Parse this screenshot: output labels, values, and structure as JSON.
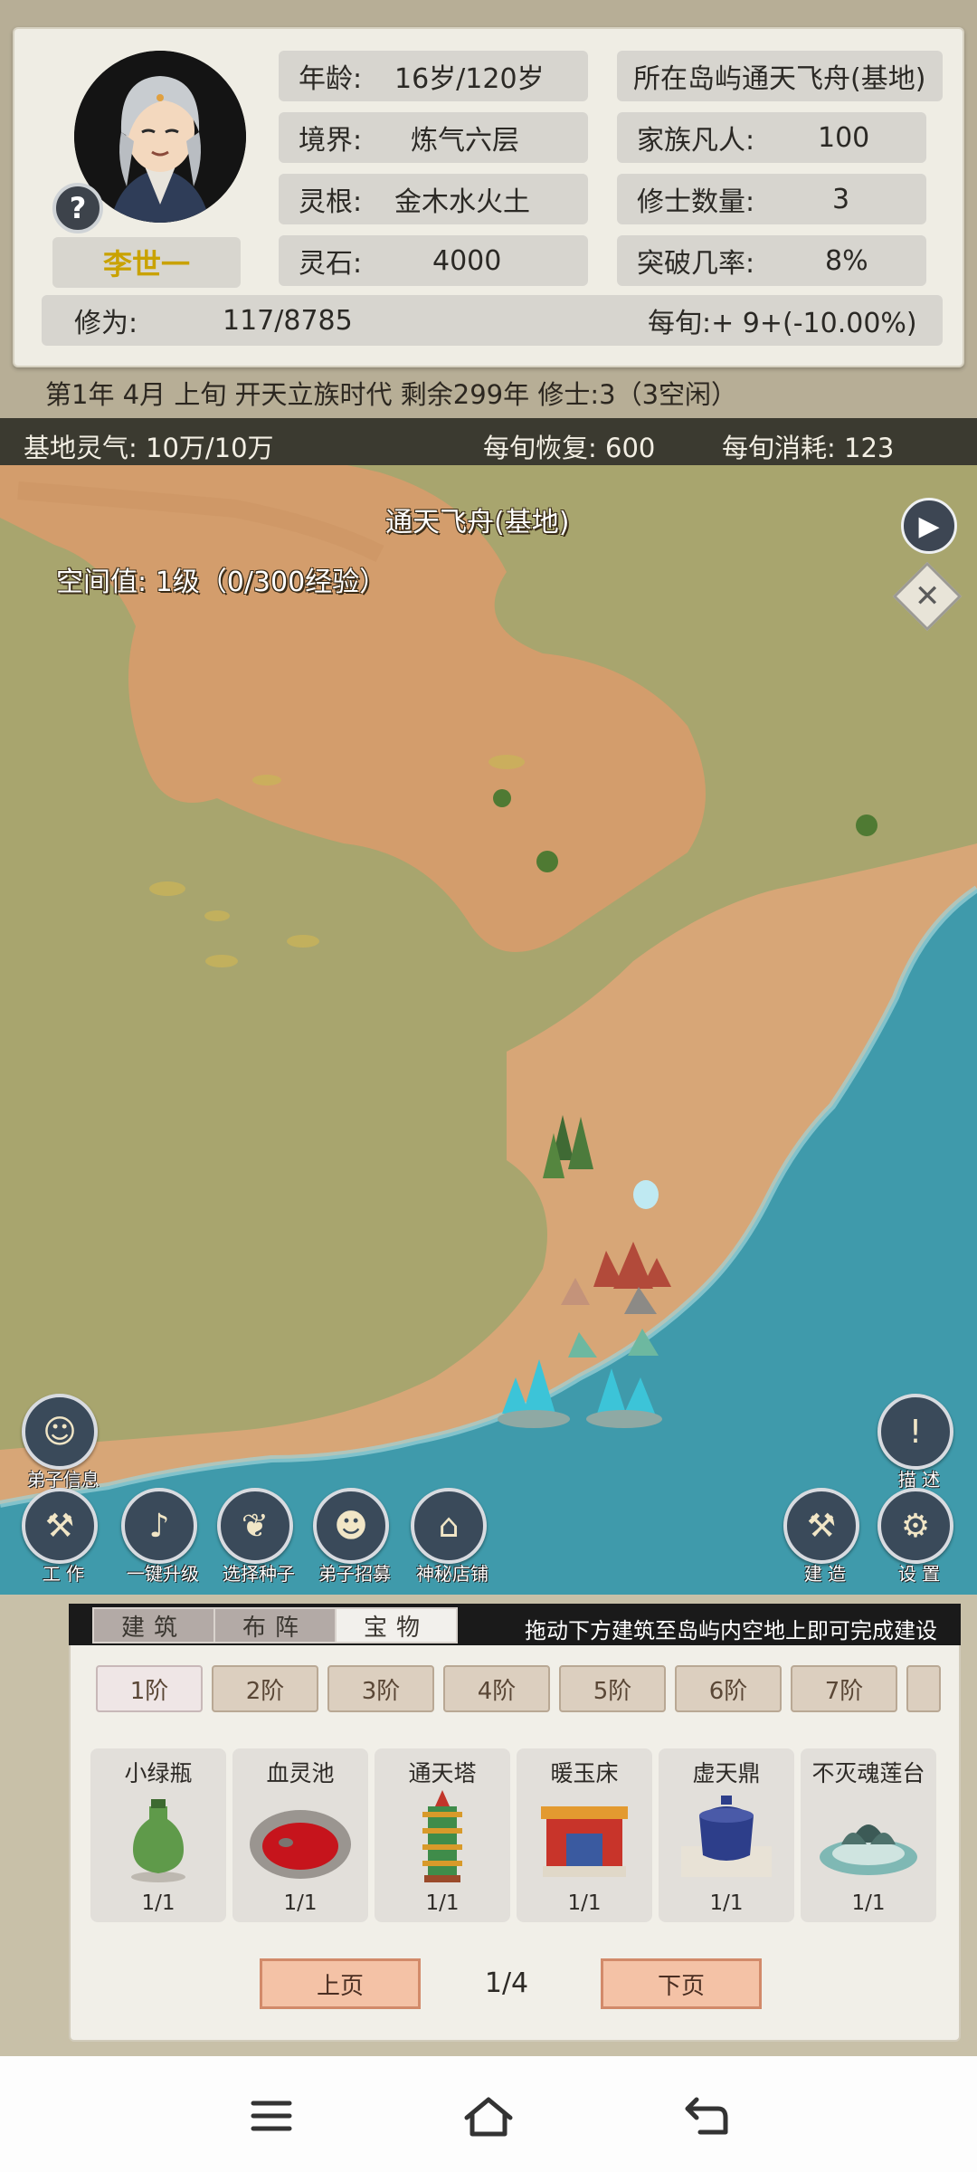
{
  "profile": {
    "name": "李世一",
    "age_label": "年龄:",
    "age_value": "16岁/120岁",
    "realm_label": "境界:",
    "realm_value": "炼气六层",
    "root_label": "灵根:",
    "root_value": "金木水火土",
    "stones_label": "灵石:",
    "stones_value": "4000",
    "island_label": "所在岛屿",
    "island_value": "通天飞舟(基地)",
    "mortals_label": "家族凡人:",
    "mortals_value": "100",
    "cultivators_label": "修士数量:",
    "cultivators_value": "3",
    "breakthrough_label": "突破几率:",
    "breakthrough_value": "8%",
    "cultivation_label": "修为:",
    "cultivation_value": "117/8785",
    "per_turn": "每旬:+ 9+(-10.00%)",
    "help_icon": "?"
  },
  "status_line": "第1年 4月 上旬  开天立族时代 剩余299年  修士:3（3空闲）",
  "qi_bar": {
    "base_qi": "基地灵气: 10万/10万",
    "recovery": "每旬恢复: 600",
    "consumption": "每旬消耗: 123"
  },
  "map": {
    "location_title": "通天飞舟(基地)",
    "space_value": "空间值: 1级（0/300经验）",
    "terrain_colors": {
      "grass": "#a8a56e",
      "sand": "#d59c6c",
      "sea": "#3f9aab",
      "shore": "#d7a677"
    }
  },
  "buttons": {
    "disciple_info": "弟子信息",
    "work": "工 作",
    "upgrade_all": "一键升级",
    "select_seeds": "选择种子",
    "recruit": "弟子招募",
    "mystery_shop": "神秘店铺",
    "describe": "描 述",
    "build": "建 造",
    "settings": "设 置"
  },
  "build_panel": {
    "tabs": [
      "建筑",
      "布阵",
      "宝物"
    ],
    "active_tab": "宝物",
    "hint": "拖动下方建筑至岛屿内空地上即可完成建设",
    "tiers": [
      "1阶",
      "2阶",
      "3阶",
      "4阶",
      "5阶",
      "6阶",
      "7阶"
    ],
    "items": [
      {
        "name": "小绿瓶",
        "count": "1/1"
      },
      {
        "name": "血灵池",
        "count": "1/1"
      },
      {
        "name": "通天塔",
        "count": "1/1"
      },
      {
        "name": "暖玉床",
        "count": "1/1"
      },
      {
        "name": "虚天鼎",
        "count": "1/1"
      },
      {
        "name": "不灭魂莲台",
        "count": "1/1"
      }
    ],
    "prev_page": "上页",
    "next_page": "下页",
    "page_indicator": "1/4"
  },
  "navbar": {
    "menu_icon": "menu-icon",
    "home_icon": "home-icon",
    "back_icon": "back-icon"
  }
}
